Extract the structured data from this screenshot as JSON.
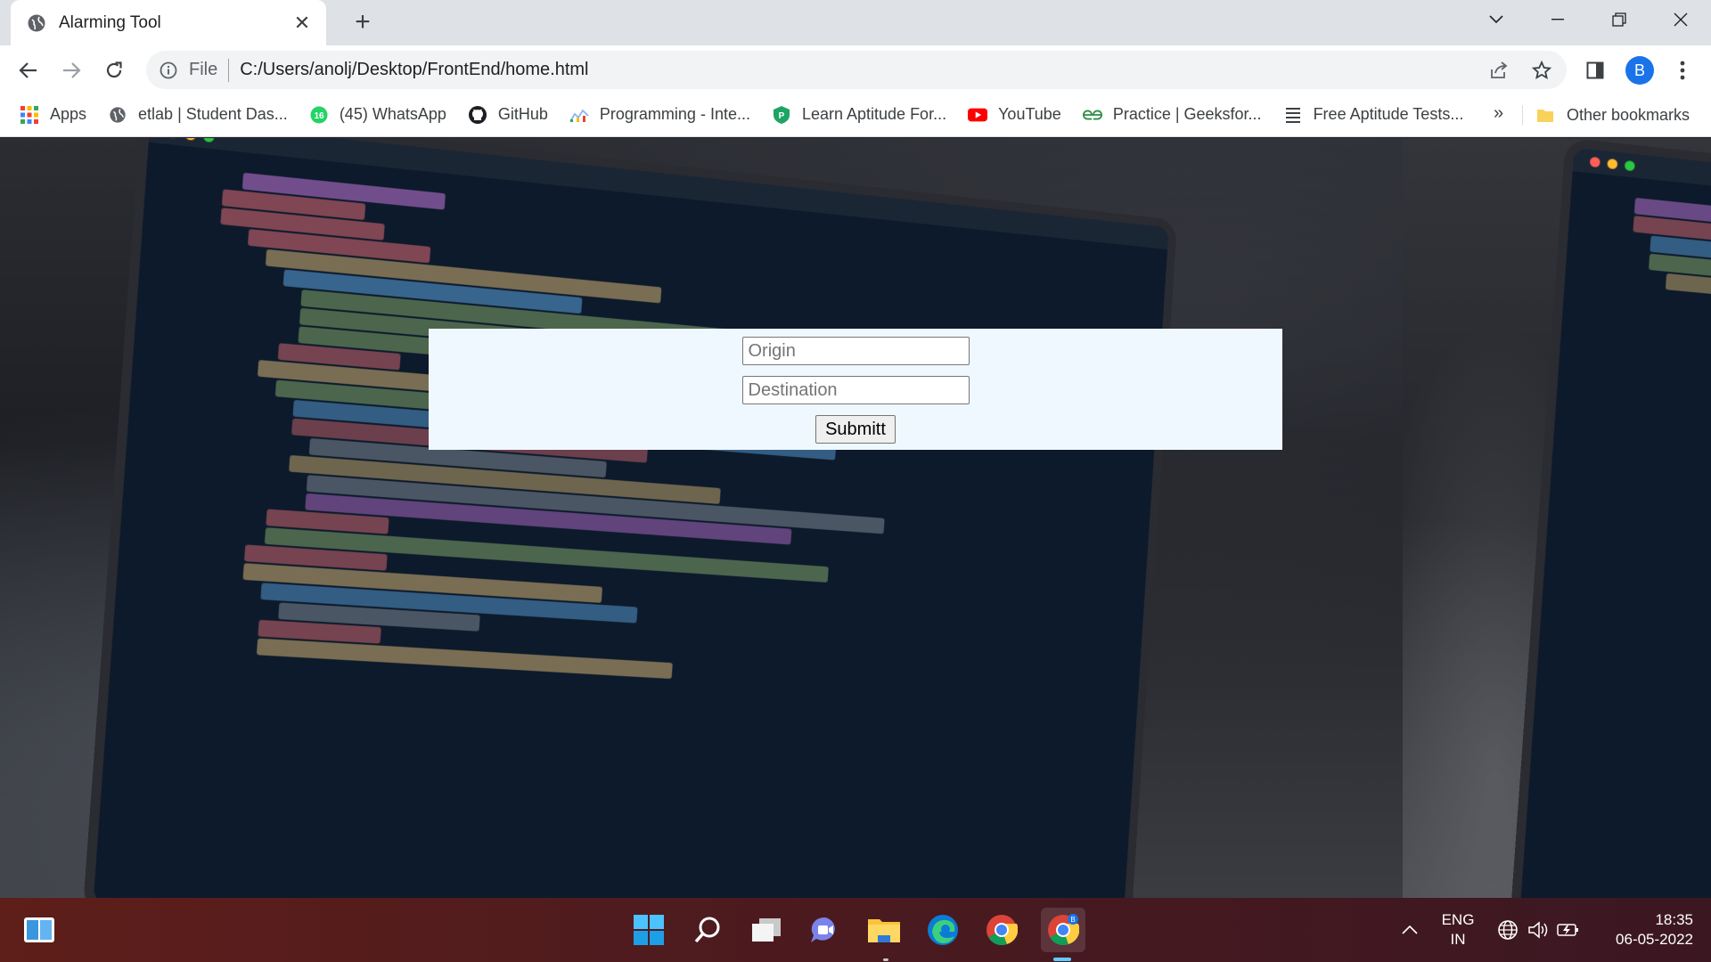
{
  "browser": {
    "tab": {
      "title": "Alarming Tool"
    },
    "address": {
      "scheme": "File",
      "url": "C:/Users/anolj/Desktop/FrontEnd/home.html"
    },
    "profile_initial": "B"
  },
  "bookmarks": {
    "items": [
      {
        "label": "Apps",
        "icon": "apps-grid-icon"
      },
      {
        "label": "etlab | Student Das...",
        "icon": "globe-icon"
      },
      {
        "label": "(45) WhatsApp",
        "icon": "whatsapp-icon",
        "badge": "16"
      },
      {
        "label": "GitHub",
        "icon": "github-icon"
      },
      {
        "label": "Programming - Inte...",
        "icon": "chart-icon"
      },
      {
        "label": "Learn Aptitude For...",
        "icon": "shield-icon"
      },
      {
        "label": "YouTube",
        "icon": "youtube-icon"
      },
      {
        "label": "Practice | Geeksfor...",
        "icon": "geeksforgeeks-icon"
      },
      {
        "label": "Free Aptitude Tests...",
        "icon": "list-icon"
      }
    ],
    "more": "»",
    "other": "Other bookmarks"
  },
  "form": {
    "origin_placeholder": "Origin",
    "destination_placeholder": "Destination",
    "submit_label": "Submitt"
  },
  "taskbar": {
    "lang_line1": "ENG",
    "lang_line2": "IN",
    "time": "18:35",
    "date": "06-05-2022"
  },
  "colors": {
    "form_bg": "#f0f8ff",
    "accent": "#1a73e8",
    "taskbar": "#4a1a1f"
  }
}
